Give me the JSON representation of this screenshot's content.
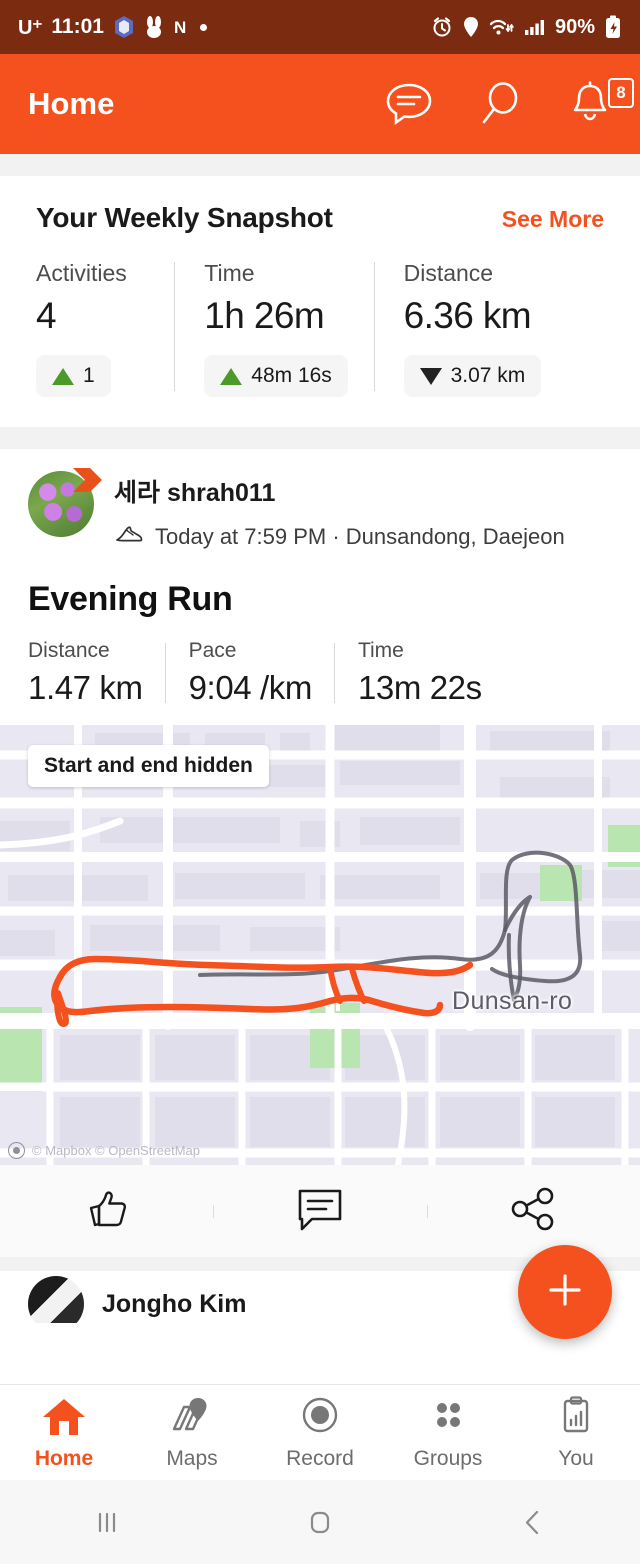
{
  "status_bar": {
    "carrier": "U⁺",
    "time": "11:01",
    "icons": [
      "app-icon-blue",
      "rabbit-icon",
      "naver-icon",
      "dot-icon"
    ],
    "naver_letter": "N",
    "right_icons": [
      "alarm-icon",
      "location-icon",
      "wifi-icon",
      "signal-icon"
    ],
    "battery": "90%",
    "battery_state": "charging"
  },
  "header": {
    "title": "Home",
    "chat_icon": "chat-bubble-icon",
    "search_icon": "search-icon",
    "bell_icon": "bell-icon",
    "notification_count": "8"
  },
  "snapshot": {
    "title": "Your Weekly Snapshot",
    "see_more": "See More",
    "stats": [
      {
        "label": "Activities",
        "value": "4",
        "delta": "1",
        "direction": "up"
      },
      {
        "label": "Time",
        "value": "1h 26m",
        "delta": "48m 16s",
        "direction": "up"
      },
      {
        "label": "Distance",
        "value": "6.36 km",
        "delta": "3.07 km",
        "direction": "down"
      }
    ]
  },
  "post": {
    "user_name": "세라 shrah011",
    "activity_icon": "running-shoe-icon",
    "subtitle": "Today at 7:59 PM · Dunsandong, Daejeon",
    "title": "Evening Run",
    "stats": [
      {
        "label": "Distance",
        "value": "1.47 km"
      },
      {
        "label": "Pace",
        "value": "9:04 /km"
      },
      {
        "label": "Time",
        "value": "13m 22s"
      }
    ],
    "map": {
      "privacy_chip": "Start and end hidden",
      "road_label": "Dunsan-ro",
      "attribution": "© Mapbox © OpenStreetMap",
      "route_color": "#F4511E",
      "track_color": "#5a5a66"
    },
    "actions": [
      {
        "name": "like-button",
        "icon": "thumbs-up-icon"
      },
      {
        "name": "comment-button",
        "icon": "comment-icon"
      },
      {
        "name": "share-button",
        "icon": "share-icon"
      }
    ]
  },
  "next_post": {
    "user_name": "Jongho Kim",
    "menu": "•••"
  },
  "fab": {
    "icon": "plus-icon",
    "label": "+"
  },
  "bottom_nav": {
    "items": [
      {
        "label": "Home",
        "icon": "home-icon",
        "active": true
      },
      {
        "label": "Maps",
        "icon": "map-pin-icon",
        "active": false
      },
      {
        "label": "Record",
        "icon": "record-icon",
        "active": false
      },
      {
        "label": "Groups",
        "icon": "groups-icon",
        "active": false
      },
      {
        "label": "You",
        "icon": "clipboard-chart-icon",
        "active": false
      }
    ]
  },
  "android_nav": {
    "recents": "recents-icon",
    "home": "home-square-icon",
    "back": "back-chevron-icon"
  },
  "colors": {
    "brand_orange": "#F4511E",
    "status_bar": "#7A2B10",
    "up_green": "#4C9A2A",
    "map_base": "#E9E7F1",
    "map_park": "#B8E5B0"
  }
}
